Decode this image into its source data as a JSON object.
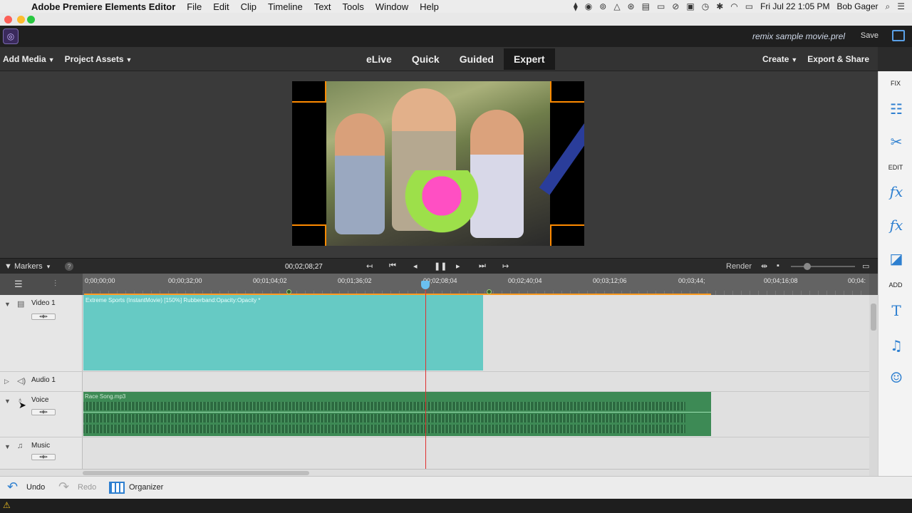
{
  "menubar": {
    "app_name": "Adobe Premiere Elements Editor",
    "items": [
      "File",
      "Edit",
      "Clip",
      "Timeline",
      "Text",
      "Tools",
      "Window",
      "Help"
    ],
    "datetime": "Fri Jul 22  1:05 PM",
    "user": "Bob Gager"
  },
  "header": {
    "project_name": "remix sample movie.prel",
    "save_label": "Save"
  },
  "modebar": {
    "add_media": "Add Media",
    "project_assets": "Project Assets",
    "modes": [
      "eLive",
      "Quick",
      "Guided",
      "Expert"
    ],
    "active_mode": "Expert",
    "create": "Create",
    "export_share": "Export & Share"
  },
  "timeline_toolbar": {
    "markers_label": "Markers",
    "current_time": "00;02;08;27",
    "render_label": "Render"
  },
  "ruler": {
    "labels": [
      "0;00;00;00",
      "00;00;32;00",
      "00;01;04;02",
      "00;01;36;02",
      "00;02;08;04",
      "00;02;40;04",
      "00;03;12;06",
      "00;03;44;",
      "00;04;16;08",
      "00;04:"
    ]
  },
  "tracks": {
    "video1": {
      "name": "Video 1",
      "clip_label": "Extreme Sports (InstantMovie) [150%] Rubberband:Opacity:Opacity *"
    },
    "audio1": {
      "name": "Audio 1"
    },
    "voice": {
      "name": "Voice",
      "clip_label": "Race Song.mp3"
    },
    "music": {
      "name": "Music"
    }
  },
  "right_panel": {
    "fix": "FIX",
    "edit": "EDIT",
    "add": "ADD"
  },
  "bottom": {
    "undo": "Undo",
    "redo": "Redo",
    "organizer": "Organizer"
  },
  "colors": {
    "video_clip": "#66cac4",
    "audio_clip": "#3d8a55",
    "playhead": "#e03030",
    "accent": "#2d7fd0",
    "work_area": "#ff9a1f"
  }
}
